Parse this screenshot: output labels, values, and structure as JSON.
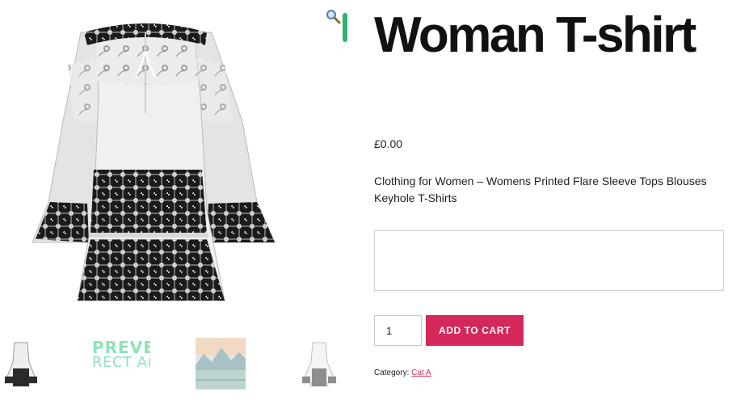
{
  "gallery": {
    "main_image_alt": "Woman T-shirt",
    "thumbnails": [
      {
        "kind": "blouse"
      },
      {
        "kind": "text",
        "line1": "PREVE",
        "line2": "RECT A("
      },
      {
        "kind": "landscape"
      },
      {
        "kind": "blouse-faded"
      }
    ]
  },
  "icons": {
    "zoom": "magnifier-icon"
  },
  "product": {
    "title": "Woman T-shirt",
    "price": "£0.00",
    "description": "Clothing for Women – Womens Printed Flare Sleeve Tops Blouses Keyhole T-Shirts"
  },
  "cart": {
    "quantity": "1",
    "add_to_cart_label": "ADD TO CART"
  },
  "meta": {
    "category_label": "Category:",
    "category_value": "Cat A"
  },
  "colors": {
    "accent": "#d4285a",
    "thumb_text": "#8fe3b7",
    "zoom_edge": "#2fb36b"
  }
}
